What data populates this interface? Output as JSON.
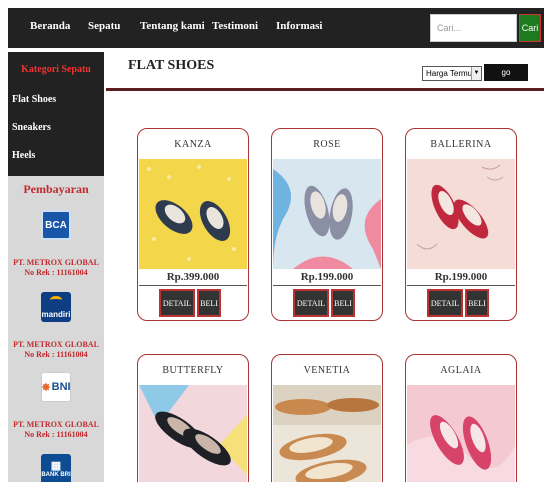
{
  "nav": {
    "items": [
      "Beranda",
      "Sepatu",
      "Tentang kami",
      "Testimoni",
      "Informasi"
    ],
    "search_placeholder": "Cari...",
    "search_button": "Cari"
  },
  "sidebar": {
    "category_title": "Kategori Sepatu",
    "categories": [
      "Flat Shoes",
      "Sneakers",
      "Heels"
    ],
    "payment_title": "Pembayaran",
    "banks": [
      {
        "logo": "BCA",
        "line1": "PT. METROX GLOBAL",
        "line2": "No Rek : 11161004"
      },
      {
        "logo": "mandiri",
        "line1": "PT. METROX GLOBAL",
        "line2": "No Rek : 11161004"
      },
      {
        "logo": "BNI",
        "line1": "PT. METROX GLOBAL",
        "line2": "No Rek : 11161004"
      },
      {
        "logo": "BANK BRI"
      }
    ]
  },
  "main": {
    "title": "FLAT SHOES",
    "sort_label": "Harga Termurah",
    "go_label": "go"
  },
  "products": [
    {
      "name": "KANZA",
      "price": "Rp.399.000",
      "bg": "#f3d64a"
    },
    {
      "name": "ROSE",
      "price": "Rp.199.000",
      "bg": "#d8e6f0"
    },
    {
      "name": "BALLERINA",
      "price": "Rp.199.000",
      "bg": "#f6dcd6"
    },
    {
      "name": "BUTTERFLY",
      "bg": "#f2d8dc"
    },
    {
      "name": "VENETIA",
      "bg": "#ece6da"
    },
    {
      "name": "AGLAIA",
      "bg": "#f5c9d2"
    }
  ],
  "buttons": {
    "detail": "DETAIL",
    "buy": "BELI"
  }
}
